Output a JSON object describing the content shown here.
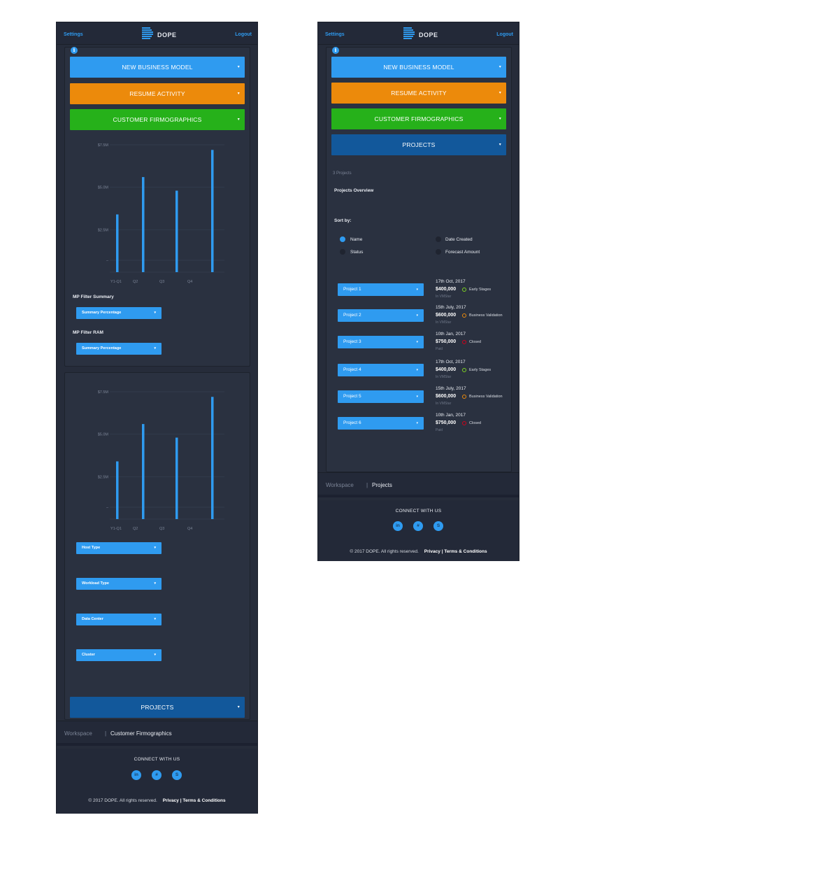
{
  "colors": {
    "accent": "#2f9bf0",
    "orange": "#ec8a0b",
    "green": "#26b11a",
    "navy": "#12589b",
    "background": "#262c3a"
  },
  "header": {
    "settings": "Settings",
    "logo": "DOPE",
    "logout": "Logout"
  },
  "menu": {
    "new_business_model": "NEW BUSINESS MODEL",
    "resume_activity": "RESUME ACTIVITY",
    "customer_firmographics": "CUSTOMER FIRMOGRAPHICS",
    "projects": "PROJECTS"
  },
  "chart_data": [
    {
      "type": "bar",
      "categories": [
        "Y1-Q1",
        "Q2",
        "Q3",
        "Q4"
      ],
      "x_ticks": [
        "Y1-Q1",
        "Q2",
        "Q3",
        "Q4"
      ],
      "values": [
        3.4,
        5.6,
        4.8,
        7.2
      ],
      "y_ticks": [
        "$7.5M",
        "$5.0M",
        "$2.5M",
        "–"
      ],
      "ylim": [
        0,
        7.5
      ],
      "grid": true
    },
    {
      "type": "bar",
      "categories": [
        "Y1-Q1",
        "Q2",
        "Q3",
        "Q4"
      ],
      "x_ticks": [
        "Y1-Q1",
        "Q2",
        "Q3",
        "Q4"
      ],
      "values": [
        3.4,
        5.6,
        4.8,
        7.2
      ],
      "y_ticks": [
        "$7.5M",
        "$5.0M",
        "$2.5M",
        "–"
      ],
      "ylim": [
        0,
        7.5
      ],
      "grid": true
    }
  ],
  "left": {
    "filter_summary_label": "MP Filter Summary",
    "filter_summary_value": "Summary Percentage",
    "filter_ram_label": "MP Filter RAM",
    "filter_ram_value": "Summary Percentage",
    "host_type": "Host Type",
    "workload_type": "Workload Type",
    "data_center": "Data Center",
    "cluster": "Cluster",
    "breadcrumb": {
      "root": "Workspace",
      "sep": "|",
      "current": "Customer Firmographics"
    }
  },
  "right": {
    "count": "3 Projects",
    "overview": "Projects Overview",
    "sort_by": "Sort by:",
    "sort_options": [
      "Name",
      "Date Created",
      "Status",
      "Forecast Amount"
    ],
    "projects": [
      {
        "name": "Project 1",
        "date": "17th Oct, 2017",
        "amount": "$400,000",
        "stage": "Early Stages",
        "status_color": "#7ed321",
        "sub": "In VMStar"
      },
      {
        "name": "Project 2",
        "date": "15th July, 2017",
        "amount": "$600,000",
        "stage": "Business Validation",
        "status_color": "#ec8a0b",
        "sub": "In VMStar"
      },
      {
        "name": "Project 3",
        "date": "10th Jan, 2017",
        "amount": "$750,000",
        "stage": "Closed",
        "status_color": "#d0021b",
        "sub": "Paid"
      },
      {
        "name": "Project 4",
        "date": "17th Oct, 2017",
        "amount": "$400,000",
        "stage": "Early Stages",
        "status_color": "#7ed321",
        "sub": "In VMStar"
      },
      {
        "name": "Project 5",
        "date": "15th July, 2017",
        "amount": "$600,000",
        "stage": "Business Validation",
        "status_color": "#ec8a0b",
        "sub": "In VMStar"
      },
      {
        "name": "Project 6",
        "date": "10th Jan, 2017",
        "amount": "$750,000",
        "stage": "Closed",
        "status_color": "#d0021b",
        "sub": "Paid"
      }
    ],
    "breadcrumb": {
      "root": "Workspace",
      "sep": "|",
      "current": "Projects"
    }
  },
  "footer": {
    "connect": "CONNECT WITH US",
    "social": [
      "linkedin-icon",
      "slack-icon",
      "skype-icon"
    ],
    "social_glyphs": [
      "in",
      "#",
      "S"
    ],
    "copyright": "© 2017 DOPE. All rights reserved.",
    "links": "Privacy | Terms & Conditions"
  }
}
